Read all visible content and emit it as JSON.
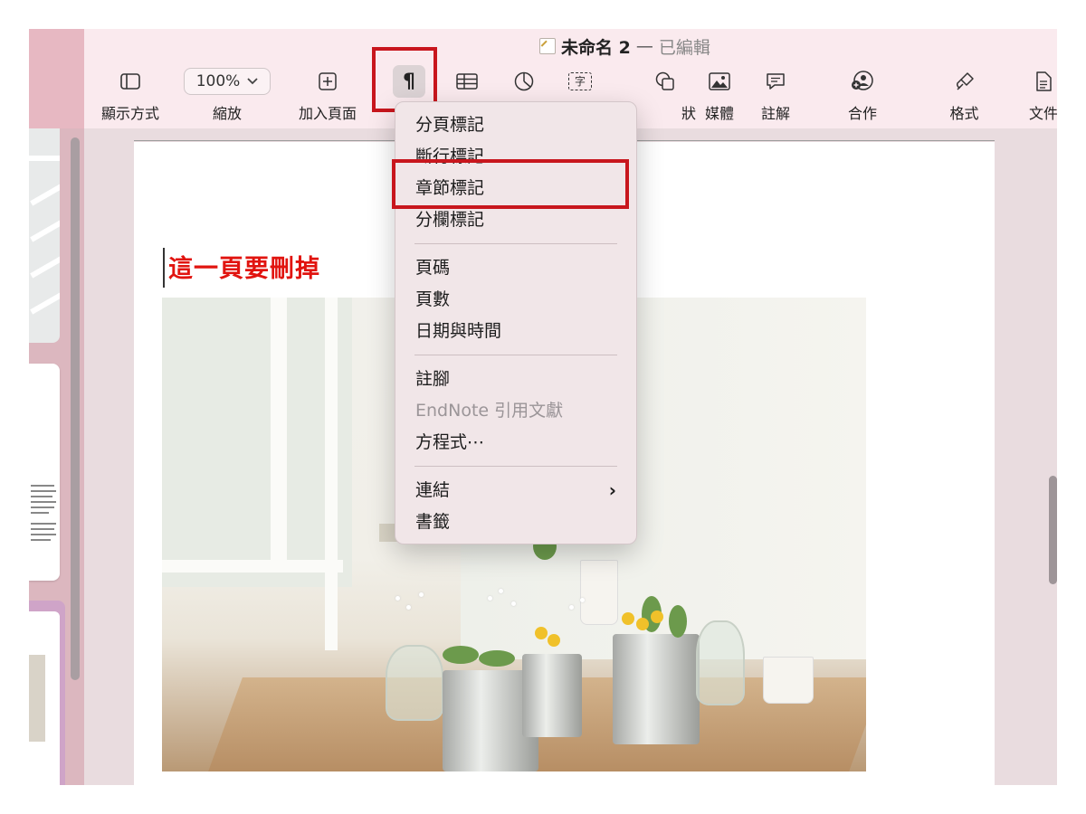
{
  "window": {
    "title": "未命名 2",
    "title_separator": "—",
    "status": "已編輯"
  },
  "toolbar": {
    "items": [
      {
        "label": "顯示方式",
        "icon": "sidebar-icon"
      },
      {
        "label": "縮放",
        "value": "100%",
        "icon": "chevron-down-icon"
      },
      {
        "label": "加入頁面",
        "icon": "add-page-icon"
      },
      {
        "label": "",
        "icon": "pilcrow-icon",
        "glyph": "¶"
      },
      {
        "label": "",
        "icon": "table-icon"
      },
      {
        "label": "",
        "icon": "chart-icon"
      },
      {
        "label": "",
        "icon": "text-box-icon",
        "glyph": "字"
      },
      {
        "label": "狀",
        "icon": "shape-icon"
      },
      {
        "label": "媒體",
        "icon": "media-icon"
      },
      {
        "label": "註解",
        "icon": "comment-icon"
      },
      {
        "label": "合作",
        "icon": "collaborate-icon"
      },
      {
        "label": "格式",
        "icon": "format-brush-icon"
      },
      {
        "label": "文件",
        "icon": "document-icon"
      }
    ]
  },
  "document": {
    "heading": "這一頁要刪掉"
  },
  "insert_menu": {
    "groups": [
      [
        "分頁標記",
        "斷行標記",
        "章節標記",
        "分欄標記"
      ],
      [
        "頁碼",
        "頁數",
        "日期與時間"
      ],
      [
        "註腳",
        "EndNote 引用文獻",
        "方程式⋯"
      ],
      [
        "連結",
        "書籤"
      ]
    ],
    "submenu_glyph": "›",
    "highlighted_item": "章節標記"
  },
  "colors": {
    "toolbar_bg": "#faeaee",
    "sidebar_bg": "#dcb7bf",
    "highlight_box": "#c8161d",
    "heading_text": "#e1140f"
  }
}
